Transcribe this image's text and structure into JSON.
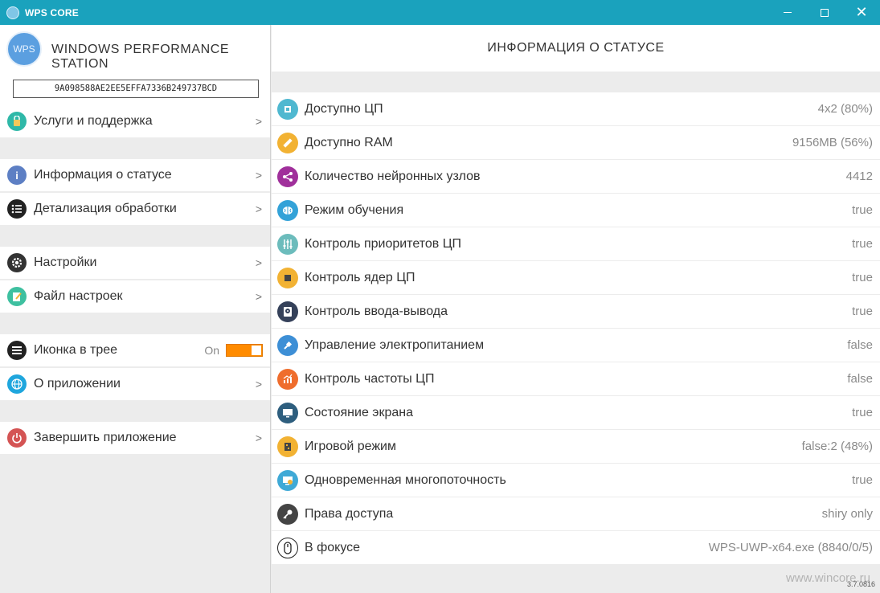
{
  "window": {
    "title": "WPS CORE"
  },
  "sidebar": {
    "brand_logo": "WPS",
    "brand_title": "WINDOWS PERFORMANCE STATION",
    "key": "9A098588AE2EE5EFFA7336B249737BCD",
    "items": [
      {
        "label": "Услуги и поддержка",
        "icon": "support-icon",
        "color": "#2fb8a8"
      },
      {
        "label": "Информация о статусе",
        "icon": "info-icon",
        "color": "#5d7fc4"
      },
      {
        "label": "Детализация обработки",
        "icon": "list-icon",
        "color": "#222222"
      },
      {
        "label": "Настройки",
        "icon": "gear-icon",
        "color": "#333333"
      },
      {
        "label": "Файл настроек",
        "icon": "notepad-icon",
        "color": "#3ec0a0"
      },
      {
        "label": "Иконка в трее",
        "icon": "tray-icon",
        "color": "#222222",
        "toggle_label": "On",
        "toggle_value": true
      },
      {
        "label": "О приложении",
        "icon": "globe-icon",
        "color": "#1fa6dd"
      },
      {
        "label": "Завершить приложение",
        "icon": "power-icon",
        "color": "#d45454"
      }
    ],
    "chevron": ">"
  },
  "main": {
    "header": "ИНФОРМАЦИЯ О СТАТУСЕ",
    "rows": [
      {
        "label": "Доступно ЦП",
        "value": "4x2 (80%)",
        "icon": "cpu-icon",
        "color": "#4fb8d0"
      },
      {
        "label": "Доступно RAM",
        "value": "9156MB (56%)",
        "icon": "ruler-icon",
        "color": "#f2b233"
      },
      {
        "label": "Количество нейронных узлов",
        "value": "4412",
        "icon": "share-icon",
        "color": "#a0309b"
      },
      {
        "label": "Режим обучения",
        "value": "true",
        "icon": "brain-icon",
        "color": "#33a2d8"
      },
      {
        "label": "Контроль приоритетов ЦП",
        "value": "true",
        "icon": "sliders-icon",
        "color": "#6cbcbc"
      },
      {
        "label": "Контроль ядер ЦП",
        "value": "true",
        "icon": "chip-icon",
        "color": "#f2b233"
      },
      {
        "label": "Контроль ввода-вывода",
        "value": "true",
        "icon": "harddisk-icon",
        "color": "#35415a"
      },
      {
        "label": "Управление электропитанием",
        "value": "false",
        "icon": "plug-icon",
        "color": "#3d8fd6"
      },
      {
        "label": "Контроль частоты ЦП",
        "value": "false",
        "icon": "chart-icon",
        "color": "#ef6d2d"
      },
      {
        "label": "Состояние экрана",
        "value": "true",
        "icon": "monitor-icon",
        "color": "#2e5e7e"
      },
      {
        "label": "Игровой режим",
        "value": "false:2 (48%)",
        "icon": "gamepad-icon",
        "color": "#f2b233"
      },
      {
        "label": "Одновременная многопоточность",
        "value": "true",
        "icon": "computer-icon",
        "color": "#3fa9d6"
      },
      {
        "label": "Права доступа",
        "value": "shiry only",
        "icon": "key-icon",
        "color": "#444444"
      },
      {
        "label": "В фокусе",
        "value": "WPS-UWP-x64.exe (8840/0/5)",
        "icon": "mouse-icon",
        "color": "#ffffff"
      }
    ]
  },
  "footer": {
    "version": "3.7.0816",
    "watermark": "www.wincore.ru"
  }
}
